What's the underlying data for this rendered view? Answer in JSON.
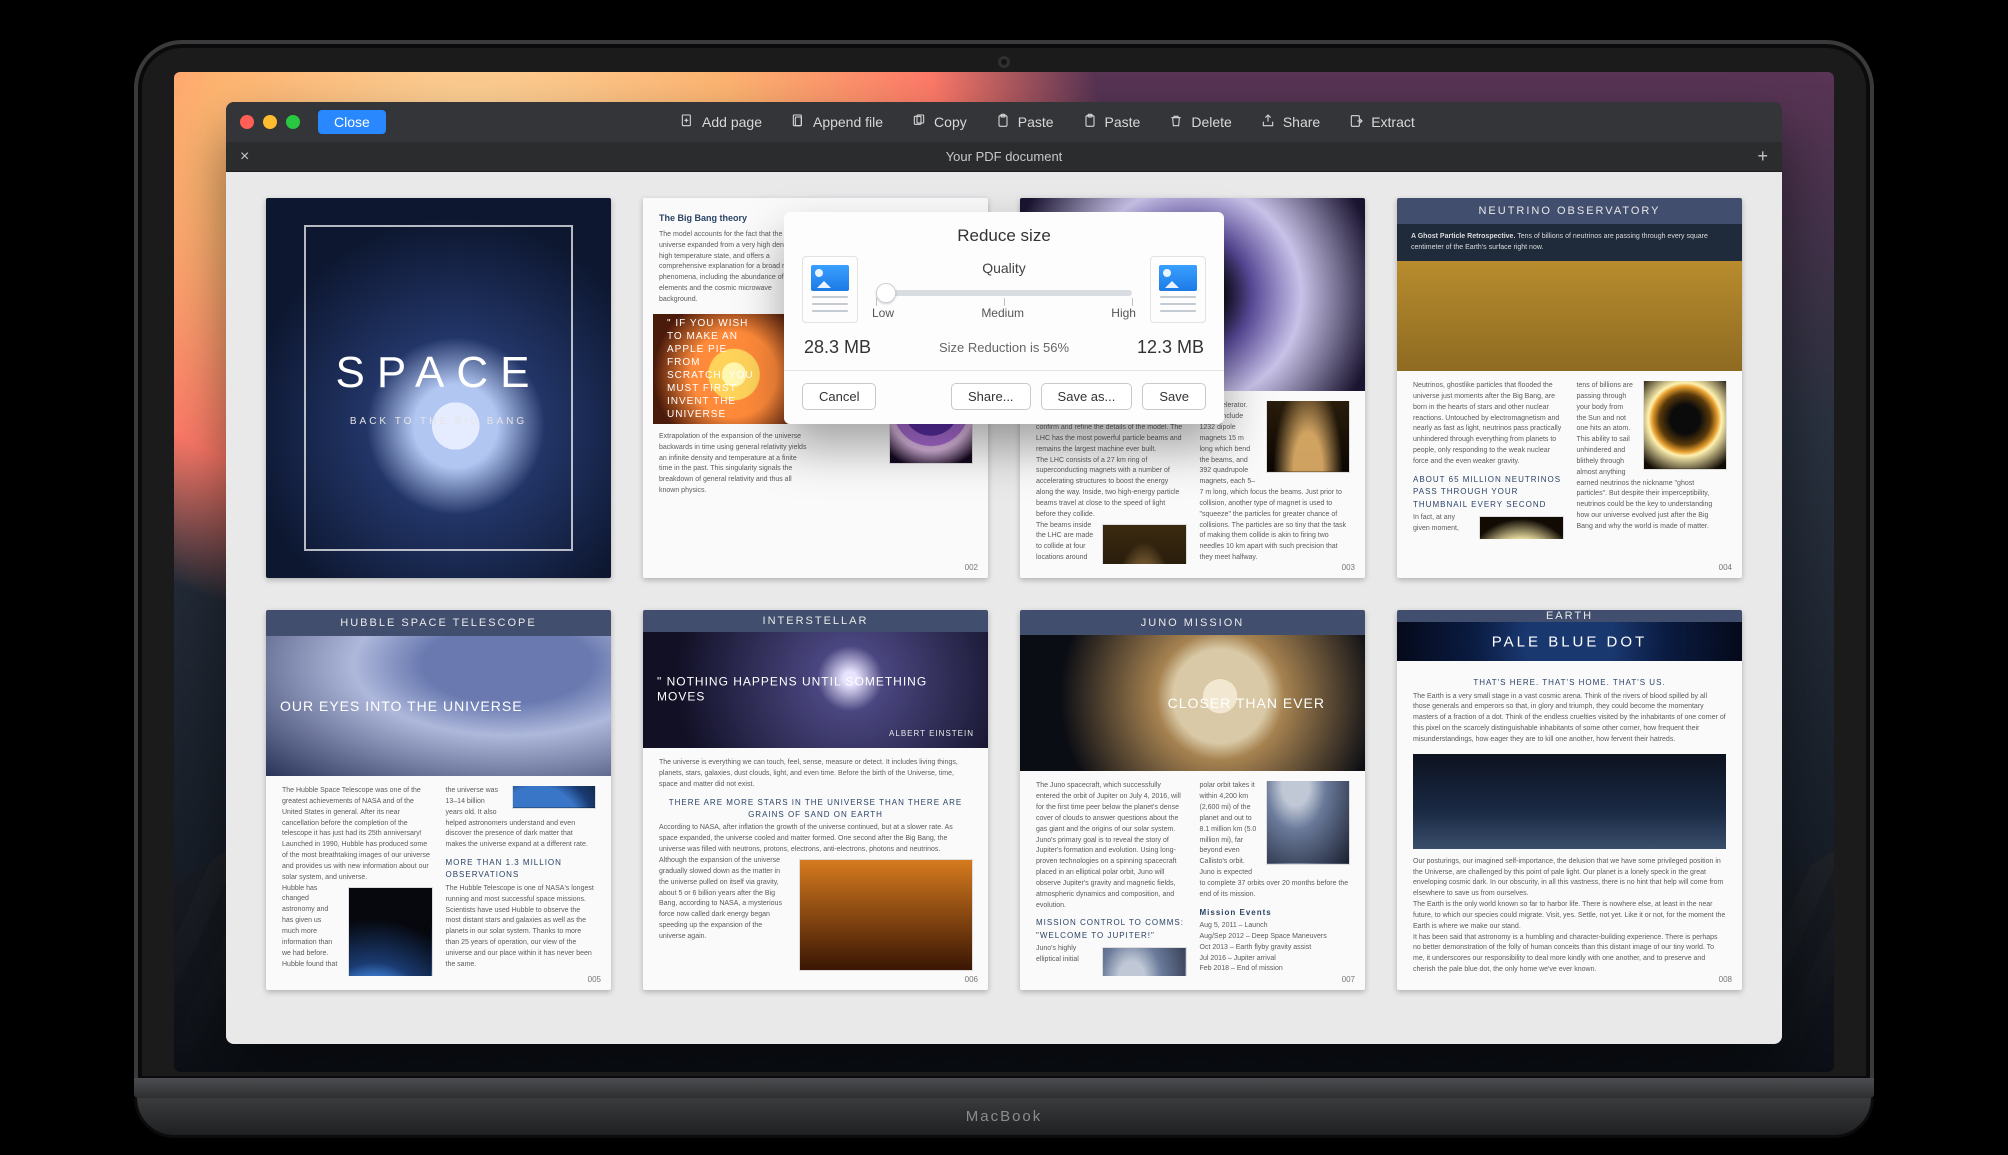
{
  "titlebar": {
    "close_label": "Close",
    "tools": {
      "add_page": "Add page",
      "append_file": "Append file",
      "copy": "Copy",
      "paste1": "Paste",
      "paste2": "Paste",
      "delete": "Delete",
      "share": "Share",
      "extract": "Extract"
    }
  },
  "subbar": {
    "close_x": "×",
    "doc_title": "Your PDF document",
    "add_tab": "+"
  },
  "pages": {
    "p1": {
      "title": "SPACE",
      "subtitle": "BACK TO THE BIG BANG"
    },
    "p2": {
      "heading": "The Big Bang theory",
      "num": "002"
    },
    "p3": {
      "num": "003"
    },
    "p4": {
      "headband": "NEUTRINO OBSERVATORY",
      "callout_title": "A Ghost Particle Retrospective.",
      "mid_headline": "ABOUT 65 MILLION NEUTRINOS PASS THROUGH YOUR THUMBNAIL EVERY SECOND",
      "num": "004"
    },
    "p5": {
      "headband": "HUBBLE SPACE TELESCOPE",
      "quote": "OUR EYES INTO THE UNIVERSE",
      "stat": "MORE THAN 1.3 MILLION OBSERVATIONS",
      "num": "005"
    },
    "p6": {
      "headband": "INTERSTELLAR",
      "quote": "NOTHING HAPPENS UNTIL SOMETHING MOVES",
      "quote_author": "ALBERT EINSTEIN",
      "mid_headline": "THERE ARE MORE STARS IN THE UNIVERSE THAN THERE ARE GRAINS OF SAND ON EARTH",
      "num": "006"
    },
    "p7": {
      "headband": "JUNO MISSION",
      "quote": "CLOSER THAN EVER",
      "mid_headline": "MISSION CONTROL TO COMMS: \"WELCOME TO JUPITER!\"",
      "events_heading": "Mission Events",
      "events": [
        "Aug 5, 2011 – Launch",
        "Aug/Sep 2012 – Deep Space Maneuvers",
        "Oct 2013 – Earth flyby gravity assist",
        "Jul 2016 – Jupiter arrival",
        "Feb 2018 – End of mission"
      ],
      "num": "007"
    },
    "p8": {
      "headband": "EARTH",
      "hero_title": "PALE BLUE DOT",
      "mid_headline": "THAT'S HERE. THAT'S HOME. THAT'S US.",
      "num": "008"
    }
  },
  "modal": {
    "title": "Reduce size",
    "quality_label": "Quality",
    "low": "Low",
    "medium": "Medium",
    "high": "High",
    "size_before": "28.3 MB",
    "size_after": "12.3 MB",
    "reduction_text": "Size Reduction is 56%",
    "cancel": "Cancel",
    "share": "Share...",
    "save_as": "Save as...",
    "save": "Save"
  },
  "laptop_brand": "MacBook"
}
